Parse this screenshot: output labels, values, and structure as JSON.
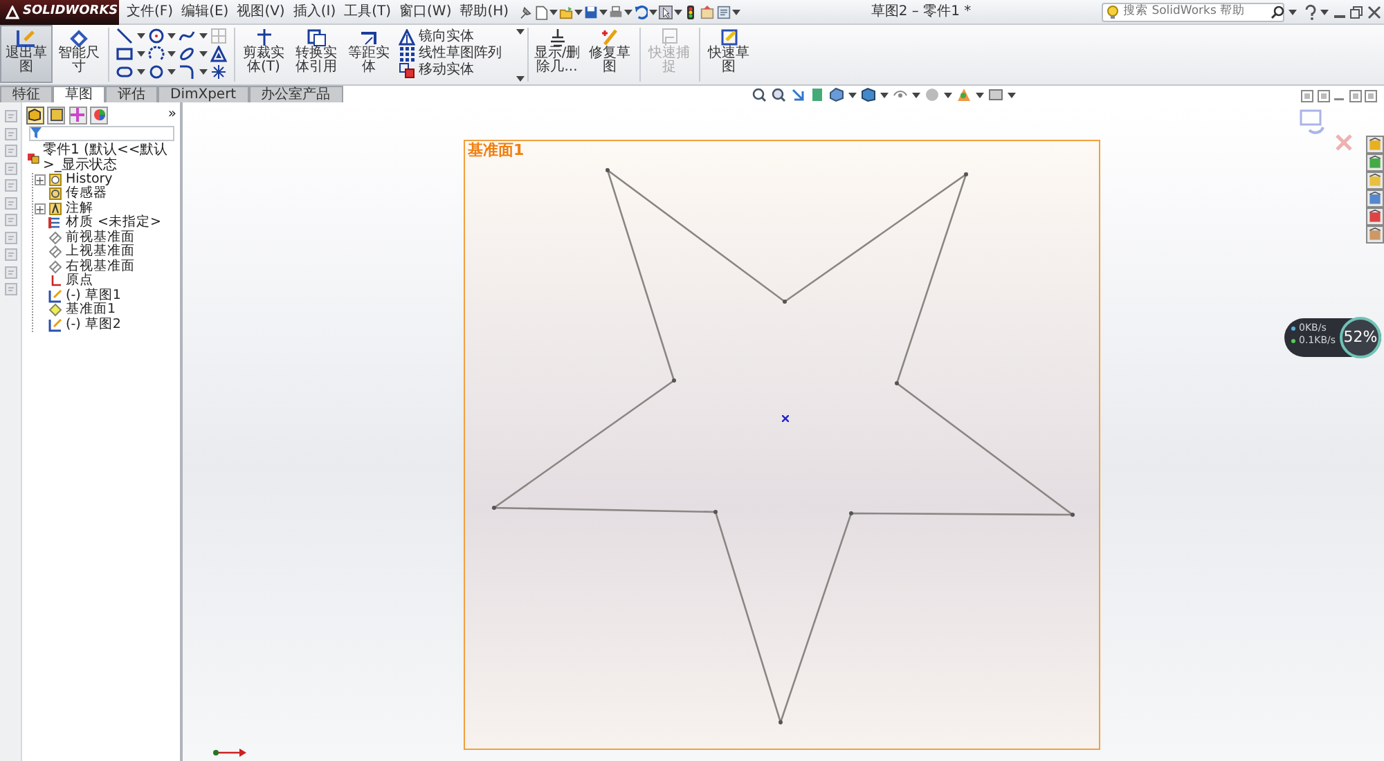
{
  "app": {
    "logo": "SOLIDWORKS",
    "menus": [
      "文件(F)",
      "编辑(E)",
      "视图(V)",
      "插入(I)",
      "工具(T)",
      "窗口(W)",
      "帮助(H)"
    ],
    "title": "草图2 – 零件1 *",
    "search": {
      "placeholder": "搜索 SolidWorks 帮助"
    }
  },
  "ribbon": {
    "sketch_buttons": [
      {
        "label": "退出草图",
        "selected": true
      },
      {
        "label": "智能尺寸",
        "selected": false
      }
    ],
    "edit_buttons": [
      "剪裁实体(T)",
      "转换实体引用",
      "等距实体"
    ],
    "edit_list": [
      "镜向实体",
      "线性草图阵列",
      "移动实体"
    ],
    "tail_buttons": [
      {
        "label": "显示/删除几...",
        "disabled": false
      },
      {
        "label": "修复草图",
        "disabled": false
      },
      {
        "label": "快速捕捉",
        "disabled": true
      },
      {
        "label": "快速草图",
        "disabled": false
      }
    ]
  },
  "tabs": [
    {
      "label": "特征",
      "selected": false
    },
    {
      "label": "草图",
      "selected": true
    },
    {
      "label": "评估",
      "selected": false
    },
    {
      "label": "DimXpert",
      "selected": false
    },
    {
      "label": "办公室产品",
      "selected": false
    }
  ],
  "tree": {
    "panel_tabs": [
      {
        "selected": true
      },
      {
        "selected": false
      },
      {
        "selected": false
      },
      {
        "selected": false
      }
    ],
    "more": "»",
    "root": {
      "label": "零件1  (默认<<默认>_显示状态",
      "kind": "part",
      "children": [
        {
          "label": "History",
          "kind": "history",
          "expander": "+"
        },
        {
          "label": "传感器",
          "kind": "sensor"
        },
        {
          "label": "注解",
          "kind": "annotation",
          "expander": "+"
        },
        {
          "label": "材质 <未指定>",
          "kind": "material"
        },
        {
          "label": "前视基准面",
          "kind": "plane"
        },
        {
          "label": "上视基准面",
          "kind": "plane"
        },
        {
          "label": "右视基准面",
          "kind": "plane"
        },
        {
          "label": "原点",
          "kind": "origin"
        },
        {
          "label": "(-) 草图1",
          "kind": "sketch"
        },
        {
          "label": "基准面1",
          "kind": "ref_plane"
        },
        {
          "label": "(-) 草图2",
          "kind": "sketch"
        }
      ]
    }
  },
  "canvas": {
    "plane_label": "基准面1"
  },
  "network": {
    "upload": "0KB/s",
    "download": "0.1KB/s",
    "percent": "52%"
  }
}
